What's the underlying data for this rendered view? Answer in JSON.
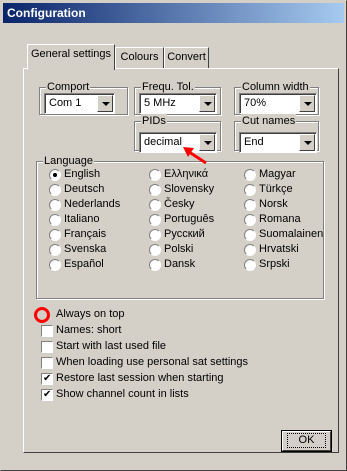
{
  "window": {
    "title": "Configuration"
  },
  "tabs": [
    "General settings",
    "Colours",
    "Convert"
  ],
  "comport": {
    "label": "Comport",
    "value": "Com 1"
  },
  "frequ_tol": {
    "label": "Frequ. Tol.",
    "value": "5 MHz"
  },
  "column_width": {
    "label": "Column width",
    "value": "70%"
  },
  "pids": {
    "label": "PIDs",
    "value": "decimal"
  },
  "cut_names": {
    "label": "Cut names",
    "value": "End"
  },
  "language": {
    "label": "Language",
    "selected": "English",
    "columns": [
      [
        "English",
        "Deutsch",
        "Nederlands",
        "Italiano",
        "Français",
        "Svenska",
        "Español"
      ],
      [
        "Ελληνικά",
        "Slovensky",
        "Česky",
        "Português",
        "Русский",
        "Polski",
        "Dansk"
      ],
      [
        "Magyar",
        "Türkçe",
        "Norsk",
        "Romana",
        "Suomalainen",
        "Hrvatski",
        "Srpski"
      ]
    ]
  },
  "options": [
    {
      "label": "Always on top",
      "checked": false
    },
    {
      "label": "Names: short",
      "checked": false
    },
    {
      "label": "Start with last used file",
      "checked": false
    },
    {
      "label": "When loading use personal sat settings",
      "checked": false
    },
    {
      "label": "Restore last session when starting",
      "checked": true
    },
    {
      "label": "Show channel count in lists",
      "checked": true
    }
  ],
  "ok_label": "OK",
  "annotation_color": "#ff0000"
}
